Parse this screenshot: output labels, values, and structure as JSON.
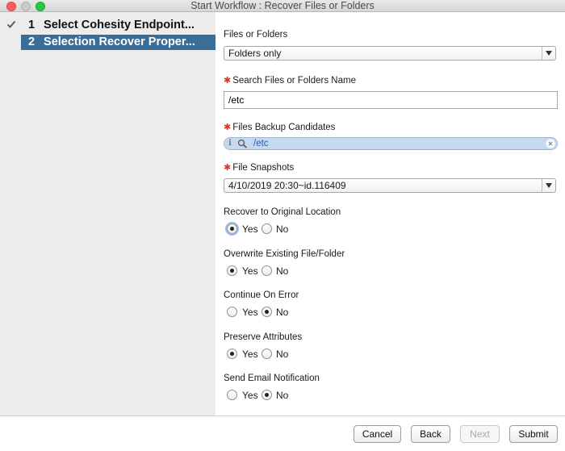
{
  "window": {
    "title": "Start Workflow : Recover Files or Folders"
  },
  "steps": [
    {
      "number": "1",
      "label": "Select Cohesity Endpoint...",
      "completed": true
    },
    {
      "number": "2",
      "label": "Selection Recover Proper...",
      "selected": true
    }
  ],
  "form": {
    "files_or_folders": {
      "label": "Files or Folders",
      "value": "Folders only"
    },
    "search_name": {
      "label": "Search Files or Folders Name",
      "value": "/etc",
      "required_marker": "✱"
    },
    "backup_candidates": {
      "label": "Files Backup Candidates",
      "value": "/etc",
      "info": "i",
      "required_marker": "✱"
    },
    "file_snapshots": {
      "label": "File Snapshots",
      "value": "4/10/2019 20:30~id.116409",
      "required_marker": "✱"
    },
    "recover_original": {
      "label": "Recover to Original Location",
      "yes": "Yes",
      "no": "No",
      "selected": "Yes"
    },
    "overwrite_existing": {
      "label": "Overwrite Existing File/Folder",
      "yes": "Yes",
      "no": "No",
      "selected": "Yes"
    },
    "continue_on_error": {
      "label": "Continue On Error",
      "yes": "Yes",
      "no": "No",
      "selected": "No"
    },
    "preserve_attributes": {
      "label": "Preserve Attributes",
      "yes": "Yes",
      "no": "No",
      "selected": "Yes"
    },
    "send_email": {
      "label": "Send Email Notification",
      "yes": "Yes",
      "no": "No",
      "selected": "No"
    }
  },
  "buttons": {
    "cancel": "Cancel",
    "back": "Back",
    "next": "Next",
    "submit": "Submit"
  },
  "colors": {
    "selected_step_bg": "#3a6e98",
    "required": "#d9342b",
    "token_bg": "#c7d9ef"
  }
}
